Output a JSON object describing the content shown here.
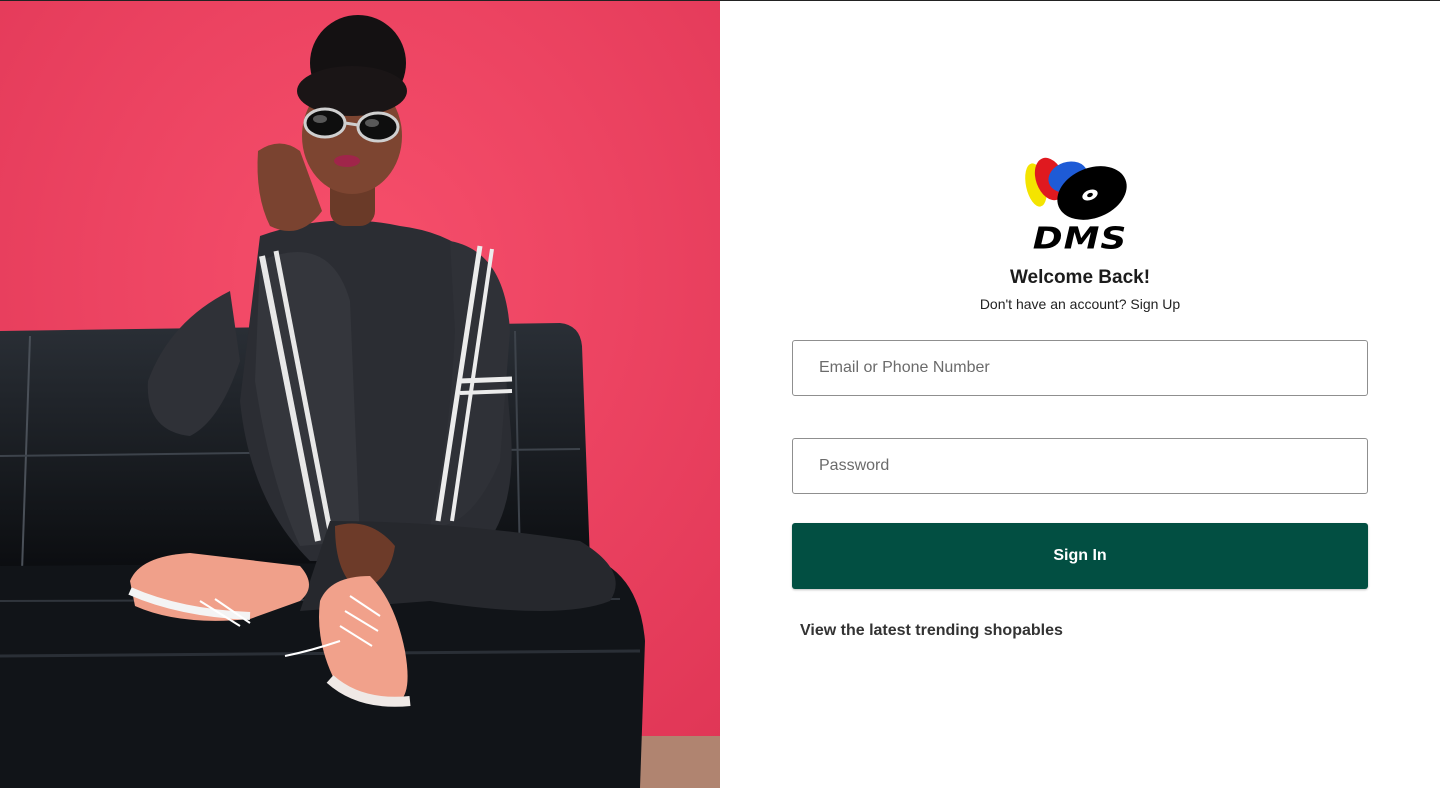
{
  "hero": {
    "image": "woman-on-black-leather-sofa-pink-wall-photo"
  },
  "brand": {
    "logo_text": "DMS",
    "logo_colors": [
      "#f4e400",
      "#e0191f",
      "#1e5bd6",
      "#000000"
    ]
  },
  "login": {
    "title": "Welcome Back!",
    "signup_prompt": "Don't have an account?",
    "signup_link": "Sign Up",
    "email_placeholder": "Email or Phone Number",
    "password_placeholder": "Password",
    "signin_label": "Sign In",
    "trending_link": "View the latest trending shopables"
  },
  "colors": {
    "primary": "#024f42",
    "hero_background": "#ee3f5f"
  }
}
